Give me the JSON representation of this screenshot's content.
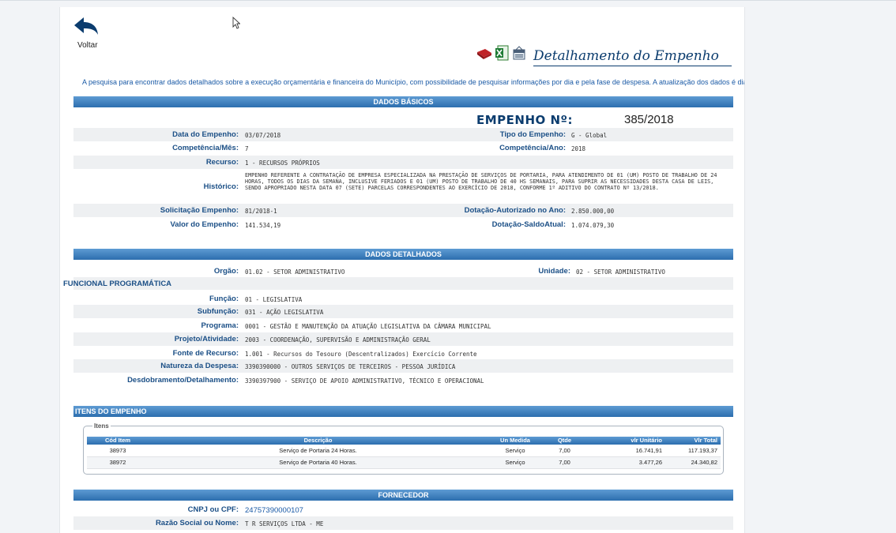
{
  "nav": {
    "back_label": "Voltar"
  },
  "header": {
    "title": "Detalhamento do Empenho",
    "intro": "A pesquisa para encontrar dados detalhados sobre a execução orçamentária e financeira do Município, com possibilidade de pesquisar informações por dia e pela fase de despesa. A atualização dos dados é diária."
  },
  "export_icons": [
    "pdf-export-icon",
    "excel-export-icon",
    "csv-export-icon"
  ],
  "dados_basicos": {
    "section_title": "DADOS BÁSICOS",
    "empenho_label": "EMPENHO Nº:",
    "empenho_numero": "385/2018",
    "data_empenho_label": "Data do Empenho:",
    "data_empenho": "03/07/2018",
    "tipo_empenho_label": "Tipo do Empenho:",
    "tipo_empenho": "G - Global",
    "competencia_mes_label": "Competência/Mês:",
    "competencia_mes": "7",
    "competencia_ano_label": "Competência/Ano:",
    "competencia_ano": "2018",
    "recurso_label": "Recurso:",
    "recurso": "1 - RECURSOS PRÓPRIOS",
    "historico_label": "Histórico:",
    "historico": "EMPENHO REFERENTE A CONTRATAÇÃO DE EMPRESA ESPECIALIZADA NA PRESTAÇÃO DE SERVIÇOS DE PORTARIA, PARA ATENDIMENTO DE 01 (UM) POSTO DE TRABALHO DE 24 HORAS, TODOS OS DIAS DA SEMANA, INCLUSIVE FERIADOS E 01 (UM) POSTO DE TRABALHO DE 40 HS SEMANAIS, PARA SUPRIR AS NECESSIDADES DESTA CASA DE LEIS, SENDO APROPRIADO NESTA DATA 07 (SETE) PARCELAS CORRESPONDENTES AO EXERCÍCIO DE 2018, CONFORME 1º ADITIVO DO CONTRATO Nº 13/2018.",
    "solicitacao_label": "Solicitação Empenho:",
    "solicitacao": "81/2018-1",
    "dotacao_autorizado_label": "Dotação-Autorizado no Ano:",
    "dotacao_autorizado": "2.850.000,00",
    "valor_label": "Valor do Empenho:",
    "valor": "141.534,19",
    "dotacao_saldo_label": "Dotação-SaldoAtual:",
    "dotacao_saldo": "1.074.079,30"
  },
  "dados_detalhados": {
    "section_title": "DADOS DETALHADOS",
    "orgao_label": "Orgão:",
    "orgao": "01.02 - SETOR ADMINISTRATIVO",
    "unidade_label": "Unidade:",
    "unidade": "02 - SETOR ADMINISTRATIVO",
    "funcional_title": "FUNCIONAL PROGRAMÁTICA",
    "funcao_label": "Função:",
    "funcao": "01 - LEGISLATIVA",
    "subfuncao_label": "Subfunção:",
    "subfuncao": "031 - AÇÃO LEGISLATIVA",
    "programa_label": "Programa:",
    "programa": "0001 - GESTÃO E MANUTENÇÃO DA ATUAÇÃO LEGISLATIVA DA CÂMARA MUNICIPAL",
    "projeto_label": "Projeto/Atividade:",
    "projeto": "2003 - COORDENAÇÃO, SUPERVISÃO E ADMINISTRAÇÃO GERAL",
    "fonte_label": "Fonte de Recurso:",
    "fonte": "1.001 - Recursos do Tesouro (Descentralizados) Exercício Corrente",
    "natureza_label": "Natureza da Despesa:",
    "natureza": "3390390000 - OUTROS SERVIÇOS DE TERCEIROS - PESSOA JURÍDICA",
    "desdobramento_label": "Desdobramento/Detalhamento:",
    "desdobramento": "3390397900 - SERVIÇO DE APOIO ADMINISTRATIVO, TÉCNICO E OPERACIONAL"
  },
  "itens": {
    "section_title": "ITENS DO EMPENHO",
    "legend": "Itens",
    "columns": [
      "Cód Item",
      "Descrição",
      "Un Medida",
      "Qtde",
      "vlr Unitário",
      "Vlr Total"
    ],
    "rows": [
      [
        "38973",
        "Serviço de Portaria 24 Horas.",
        "Serviço",
        "7,00",
        "16.741,91",
        "117.193,37"
      ],
      [
        "38972",
        "Serviço de Portaria 40 Horas.",
        "Serviço",
        "7,00",
        "3.477,26",
        "24.340,82"
      ]
    ]
  },
  "fornecedor": {
    "section_title": "FORNECEDOR",
    "cnpj_label": "CNPJ ou CPF:",
    "cnpj": "24757390000107",
    "razao_label": "Razão Social ou Nome:",
    "razao": "T R SERVIÇOS LTDA - ME"
  }
}
